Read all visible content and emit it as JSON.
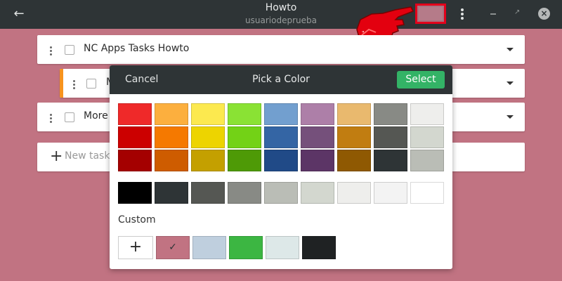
{
  "window": {
    "title": "Howto",
    "subtitle": "usuariodeprueba",
    "current_color": "#b57b89",
    "back_icon": "back-arrow-icon"
  },
  "tasks": [
    {
      "label": "NC Apps Tasks Howto"
    },
    {
      "label": "M"
    },
    {
      "label": "More"
    }
  ],
  "new_task": {
    "placeholder": "New task"
  },
  "picker": {
    "cancel_label": "Cancel",
    "title": "Pick a Color",
    "select_label": "Select",
    "palette": [
      [
        "#ef2929",
        "#fcaf3e",
        "#fce94f",
        "#8ae234",
        "#729fcf",
        "#ad7fa8",
        "#e9b96e",
        "#888a85",
        "#eeeeec"
      ],
      [
        "#cc0000",
        "#f57900",
        "#edd400",
        "#73d216",
        "#3465a4",
        "#75507b",
        "#c17d11",
        "#555753",
        "#d3d7cf"
      ],
      [
        "#a40000",
        "#ce5c00",
        "#c4a000",
        "#4e9a06",
        "#204a87",
        "#5c3566",
        "#8f5902",
        "#2e3436",
        "#babdb6"
      ]
    ],
    "grays": [
      "#000000",
      "#2e3436",
      "#555753",
      "#888a85",
      "#babdb6",
      "#d3d7cf",
      "#eeeeec",
      "#f3f3f3",
      "#ffffff"
    ],
    "custom_label": "Custom",
    "custom_colors": [
      "#c17382",
      "#bfcfde",
      "#3cb642",
      "#dde8e8",
      "#1f2223"
    ],
    "custom_selected_index": 0
  }
}
